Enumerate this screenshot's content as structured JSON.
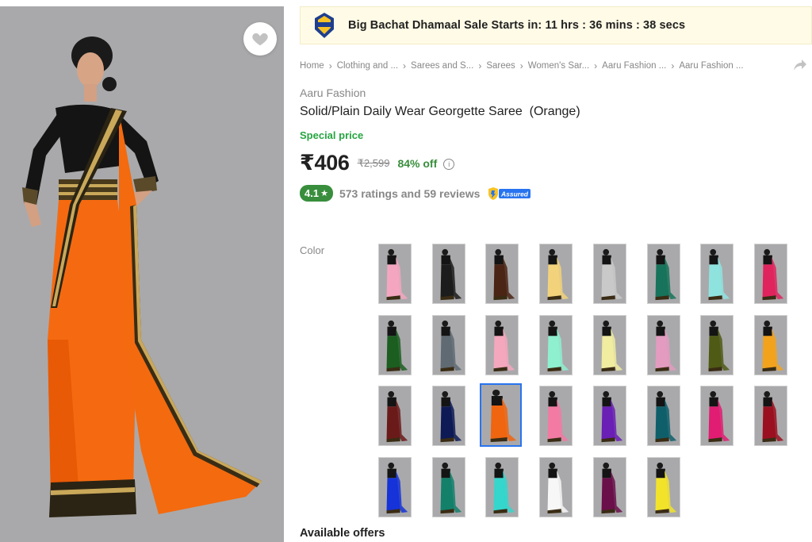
{
  "sale_banner": {
    "text": "Big Bachat Dhamaal Sale Starts in: 11 hrs : 36 mins : 38 secs",
    "logo_text": "BIG BACHAT DHAMAAL"
  },
  "breadcrumb": [
    "Home",
    "Clothing and ...",
    "Sarees and S...",
    "Sarees",
    "Women's Sar...",
    "Aaru Fashion ...",
    "Aaru Fashion ..."
  ],
  "product": {
    "brand": "Aaru Fashion",
    "title": "Solid/Plain Daily Wear Georgette Saree  (Orange)",
    "special_price_label": "Special price",
    "price": "₹406",
    "mrp": "₹2,599",
    "discount": "84% off",
    "rating": "4.1",
    "rating_star": "★",
    "ratings_reviews": "573 ratings and 59 reviews",
    "assured_label": "Assured"
  },
  "color_label": "Color",
  "selected_color": "Orange",
  "swatch_colors": [
    "#f4a6c0",
    "#1c1c1c",
    "#4a2414",
    "#f2d27a",
    "#c9c9c9",
    "#17735b",
    "#8fe3df",
    "#e0245e",
    "#1b5e20",
    "#5f6a72",
    "#f4a7bd",
    "#8ef0cf",
    "#f0eca0",
    "#e39bc0",
    "#4f5a14",
    "#f3a21b",
    "#6b1a1a",
    "#0d1a55",
    "#f0650f",
    "#f27aa3",
    "#6a1fb5",
    "#0f5f6b",
    "#e01d72",
    "#9b1020",
    "#1533d8",
    "#13806a",
    "#35d6cc",
    "#f7f7f7",
    "#6a0f4a",
    "#f2e32a"
  ],
  "icons": {
    "wishlist": "heart-icon",
    "share": "share-icon",
    "info": "info-icon"
  },
  "offers_title": "Available offers",
  "colors": {
    "price_green": "#388e3c",
    "special_green": "#26a541",
    "accent_blue": "#2874f0",
    "banner_bg": "#fffbe6"
  }
}
